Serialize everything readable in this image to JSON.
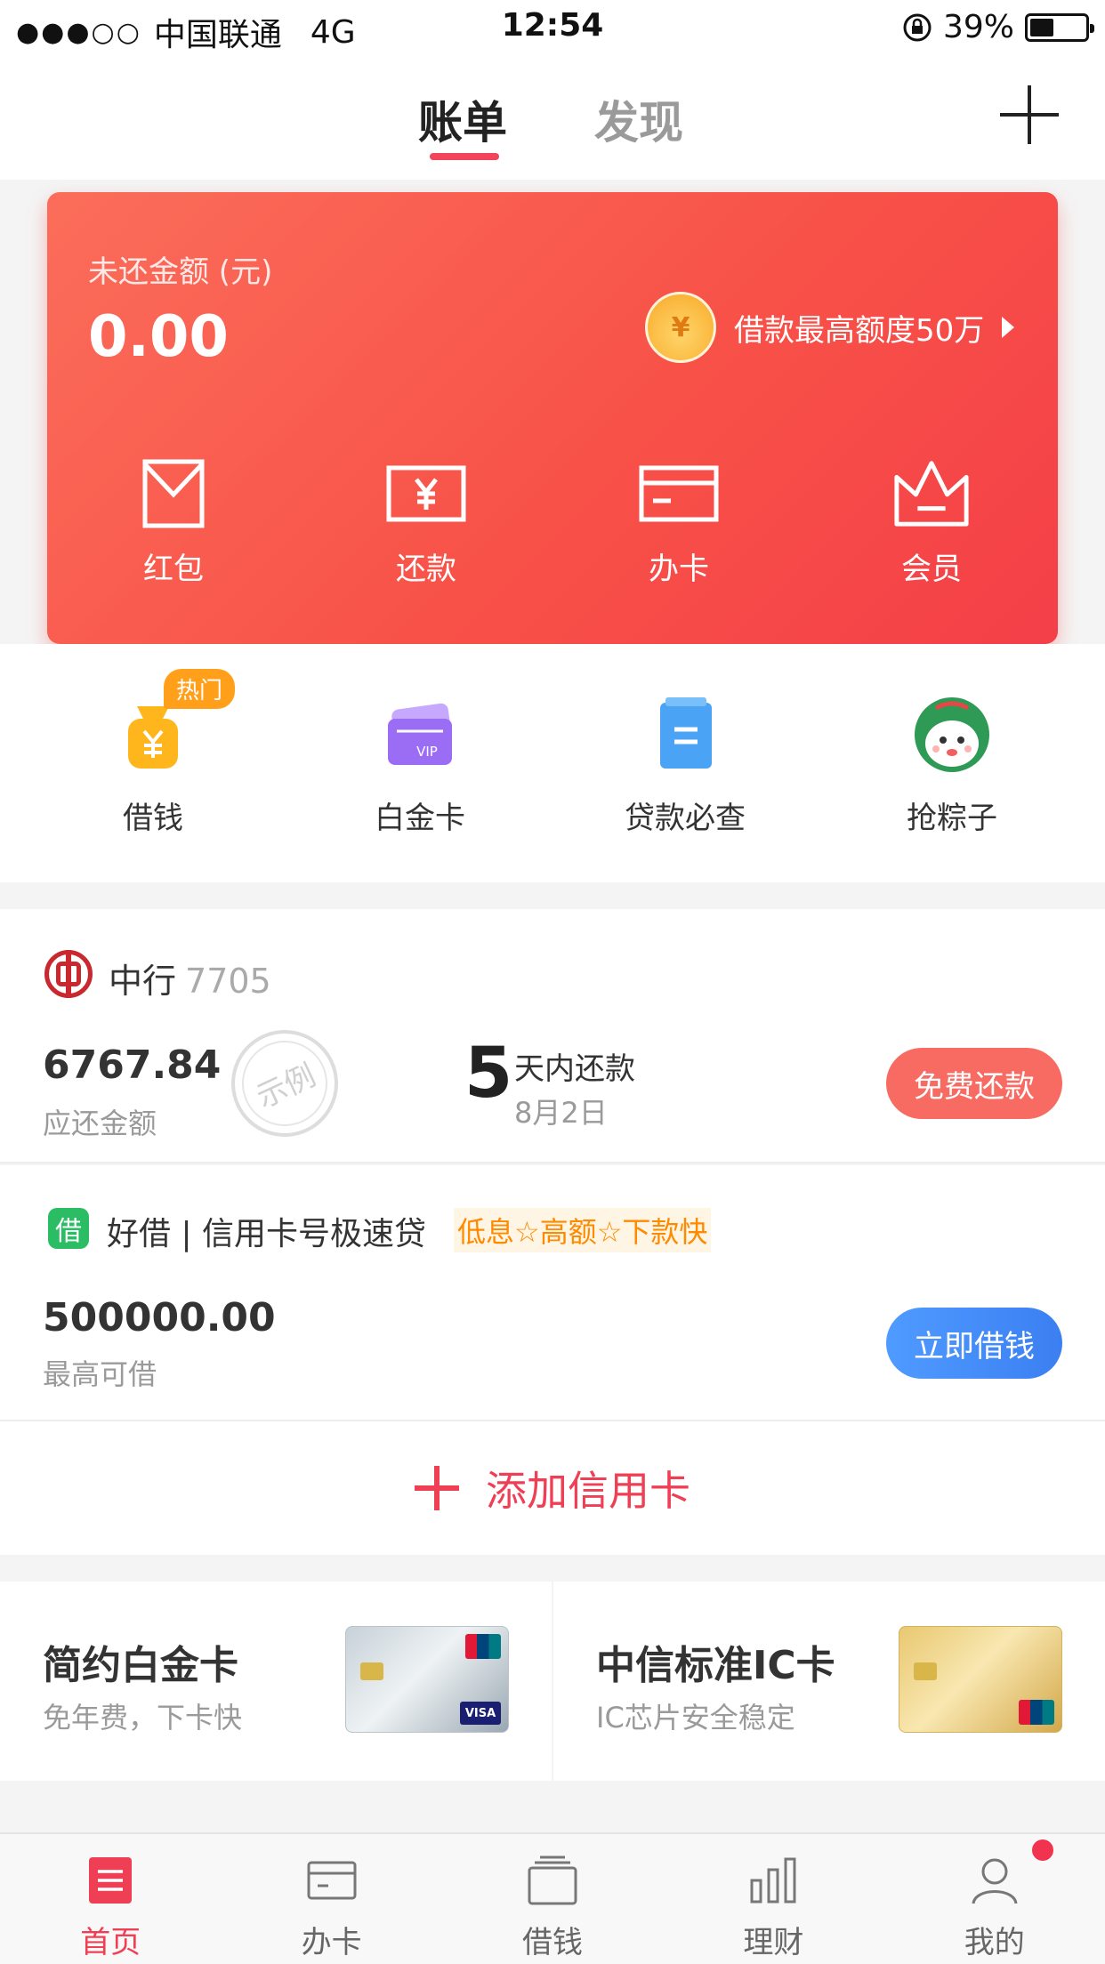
{
  "status_bar": {
    "signal_dots": "●●●○○",
    "carrier": "中国联通",
    "network": "4G",
    "time": "12:54",
    "battery_percent": "39%",
    "battery_level": 0.39
  },
  "top_nav": {
    "tabs": [
      {
        "label": "账单",
        "active": true
      },
      {
        "label": "发现",
        "active": false
      }
    ],
    "add_icon": "plus-icon"
  },
  "summary_card": {
    "label": "未还金额 (元)",
    "amount": "0.00",
    "loan_promo": "借款最高额度50万",
    "pig_symbol": "¥",
    "actions": [
      {
        "label": "红包",
        "icon": "envelope-icon"
      },
      {
        "label": "还款",
        "icon": "yen-bill-icon"
      },
      {
        "label": "办卡",
        "icon": "card-icon"
      },
      {
        "label": "会员",
        "icon": "crown-icon"
      }
    ],
    "colors": {
      "start": "#fb6d5a",
      "end": "#f43f48"
    }
  },
  "quick_functions": [
    {
      "label": "借钱",
      "icon": "money-bag-icon",
      "badge": "热门"
    },
    {
      "label": "白金卡",
      "icon": "vip-card-icon",
      "badge": ""
    },
    {
      "label": "贷款必查",
      "icon": "clipboard-icon",
      "badge": ""
    },
    {
      "label": "抢粽子",
      "icon": "zongzi-icon",
      "badge": ""
    }
  ],
  "bank_card": {
    "bank_name": "中行",
    "card_tail": "7705",
    "due_amount": "6767.84",
    "due_label": "应还金额",
    "stamp_text": "示例",
    "days_num": "5",
    "days_label": "天内还款",
    "due_date": "8月2日",
    "pay_button": "免费还款"
  },
  "loan_offer": {
    "logo_char": "借",
    "title": "好借 | 信用卡号极速贷",
    "tag": "低息☆高额☆下款快",
    "amount": "500000.00",
    "amount_label": "最高可借",
    "button": "立即借钱"
  },
  "add_card": {
    "label": "添加信用卡"
  },
  "promo_cards": [
    {
      "title": "简约白金卡",
      "subtitle": "免年费，下卡快"
    },
    {
      "title": "中信标准IC卡",
      "subtitle": "IC芯片安全稳定"
    }
  ],
  "tab_bar": {
    "items": [
      {
        "label": "首页",
        "icon": "home-list-icon",
        "active": true
      },
      {
        "label": "办卡",
        "icon": "card-icon",
        "active": false
      },
      {
        "label": "借钱",
        "icon": "wallet-stack-icon",
        "active": false
      },
      {
        "label": "理财",
        "icon": "bar-chart-icon",
        "active": false
      },
      {
        "label": "我的",
        "icon": "person-icon",
        "active": false
      }
    ],
    "accent": "#ef3f55"
  }
}
